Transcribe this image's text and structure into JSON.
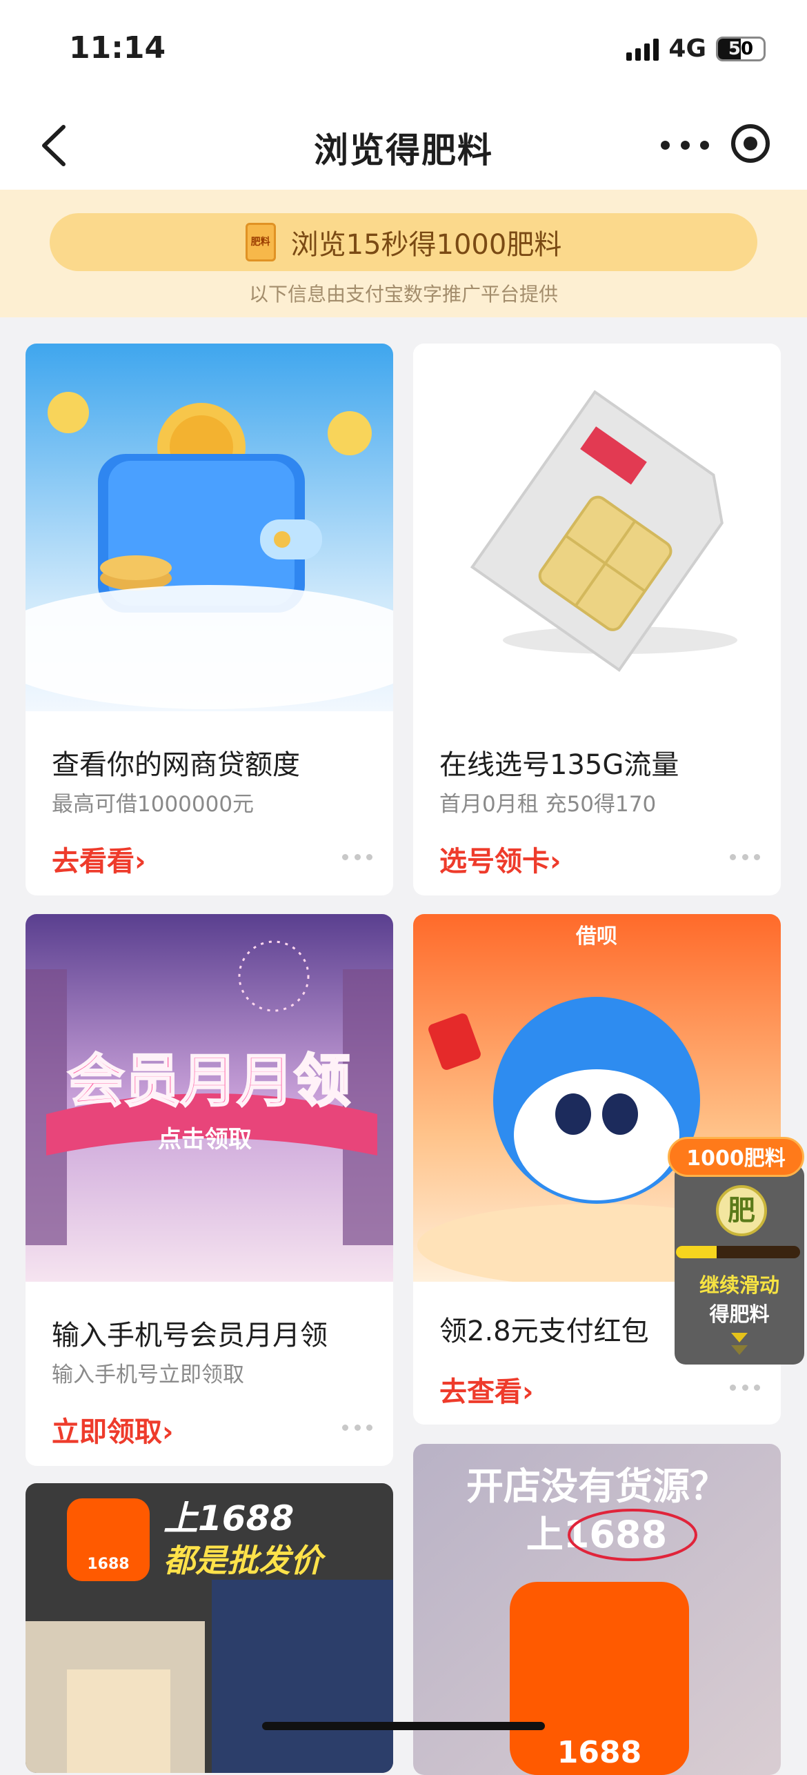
{
  "status_bar": {
    "time": "11:14",
    "network": "4G",
    "battery_level": 50,
    "battery_label": "50"
  },
  "nav": {
    "title": "浏览得肥料",
    "back_icon": "chevron-left-icon",
    "more_icon": "more-horizontal-icon",
    "record_icon": "record-circle-icon"
  },
  "promo": {
    "icon_label": "肥料",
    "text": "浏览15秒得1000肥料",
    "subtext": "以下信息由支付宝数字推广平台提供"
  },
  "cards": [
    {
      "title": "查看你的网商贷额度",
      "desc": "最高可借1000000元",
      "cta": "去看看›"
    },
    {
      "title": "在线选号135G流量",
      "desc": "首月0月租 充50得170",
      "cta": "选号领卡›"
    },
    {
      "title": "输入手机号会员月月领",
      "desc": "输入手机号立即领取",
      "cta": "立即领取›",
      "banner_text": "会员月月领",
      "banner_sub": "点击领取"
    },
    {
      "title": "领2.8元支付红包",
      "cta": "去查看›",
      "brand": "借呗"
    },
    {
      "headline1": "上1688",
      "headline2": "都是批发价",
      "logo": "1688"
    },
    {
      "headline1": "开店没有货源？",
      "headline2": "上1688",
      "logo": "1688"
    }
  ],
  "widget": {
    "tag": "1000肥料",
    "coin": "肥",
    "progress": 0.33,
    "line1": "继续滑动",
    "line2": "得肥料"
  },
  "colors": {
    "accent_red": "#ee3b2b",
    "promo_bg": "#fdefd2",
    "promo_pill": "#fbd98c",
    "brand_orange": "#ff5a00"
  }
}
